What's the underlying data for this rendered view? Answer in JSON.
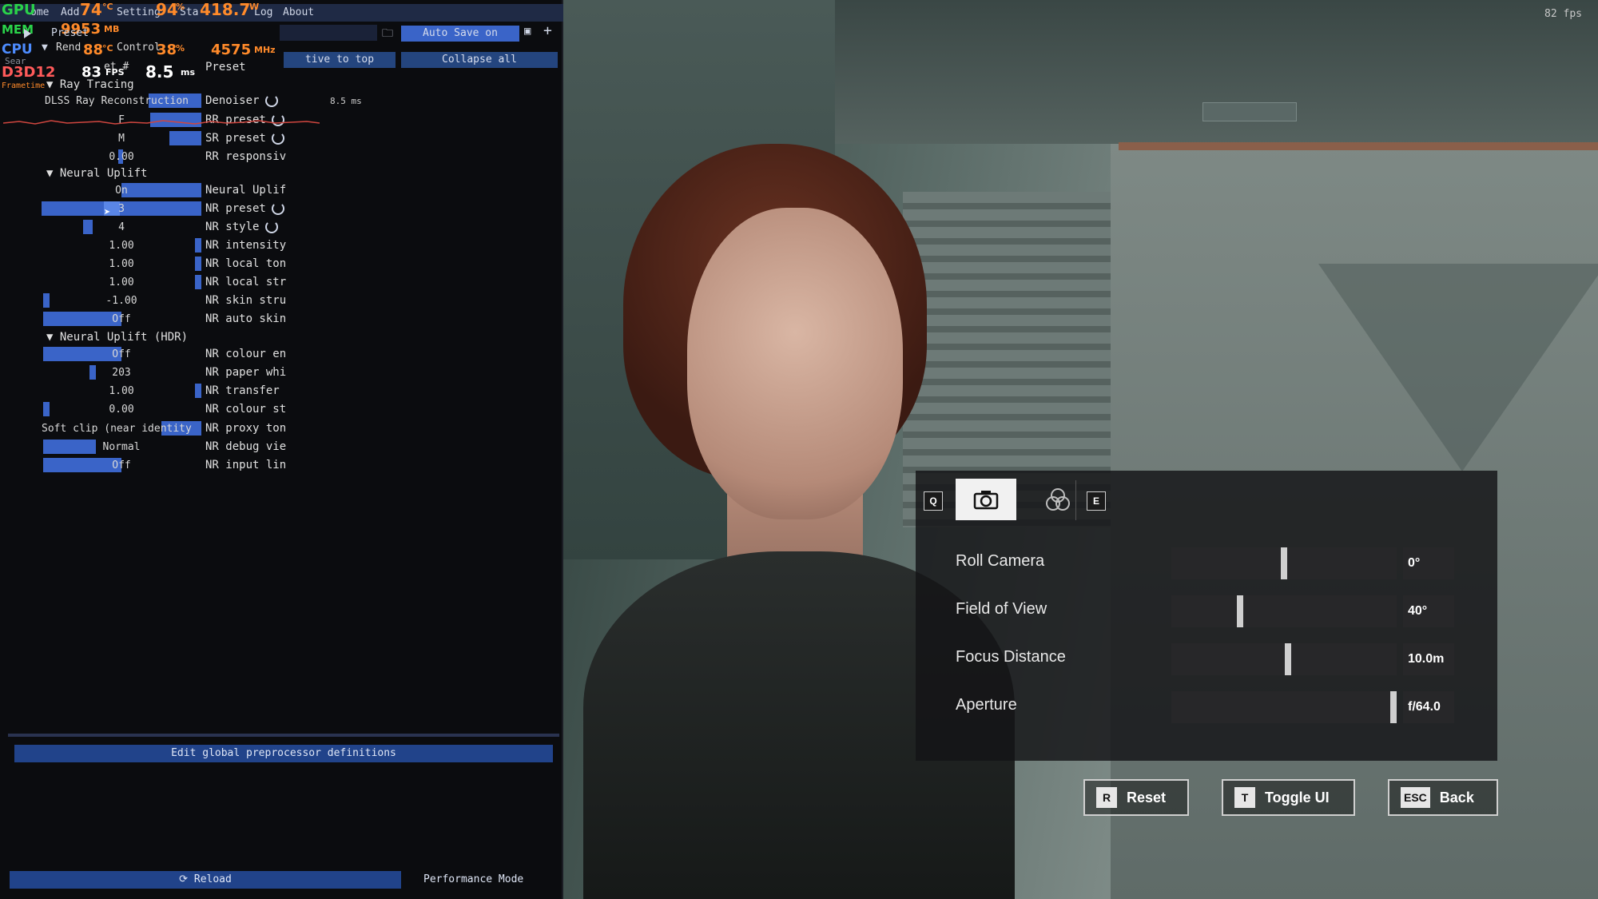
{
  "scene": {
    "fps_counter": "82 fps"
  },
  "debug_panel": {
    "menu": [
      "ome",
      "Add",
      "Setting",
      "Sta",
      "Log",
      "About"
    ],
    "overlay": {
      "gpu_label": "GPU",
      "gpu_temp": "74",
      "gpu_temp_unit": "°C",
      "gpu_load": "94",
      "gpu_load_unit": "%",
      "gpu_power": "418.7",
      "gpu_power_unit": "W",
      "mem_label": "MEM",
      "mem_value": "9953",
      "mem_unit": "MB",
      "cpu_label": "CPU",
      "cpu_temp": "88",
      "cpu_temp_unit": "°C",
      "cpu_load": "38",
      "cpu_load_unit": "%",
      "cpu_clock": "4575",
      "cpu_clock_unit": "MHz",
      "api_label": "D3D12",
      "fps": "83",
      "fps_unit": "FPS",
      "frametime": "8.5",
      "frametime_unit": "ms",
      "frametime_label": "Frametime",
      "graph_ms": "8.5 ms"
    },
    "toolbar": {
      "preset_label": "Preset",
      "autosave": "Auto Save on",
      "render_label": "Rend",
      "control_label": "Control",
      "set_label": "et #",
      "search_label": "Sear",
      "preset_row": "Preset",
      "active_to_top": "tive to top",
      "collapse_all": "Collapse all"
    },
    "sections": {
      "ray_tracing": "Ray Tracing",
      "neural_uplift": "Neural Uplift",
      "neural_uplift_hdr": "Neural Uplift (HDR)"
    },
    "rows": [
      {
        "value": "DLSS Ray Reconstruction",
        "label": "Denoiser"
      },
      {
        "value": "F",
        "label": "RR preset"
      },
      {
        "value": "M",
        "label": "SR preset"
      },
      {
        "value": "0.00",
        "label": "RR responsiv"
      },
      {
        "value": "On",
        "label": "Neural Uplif"
      },
      {
        "value": "3",
        "label": "NR preset"
      },
      {
        "value": "4",
        "label": "NR style"
      },
      {
        "value": "1.00",
        "label": "NR intensity"
      },
      {
        "value": "1.00",
        "label": "NR local ton"
      },
      {
        "value": "1.00",
        "label": "NR local str"
      },
      {
        "value": "-1.00",
        "label": "NR skin stru"
      },
      {
        "value": "Off",
        "label": "NR auto skin"
      },
      {
        "value": "Off",
        "label": "NR colour en"
      },
      {
        "value": "203",
        "label": "NR paper whi"
      },
      {
        "value": "1.00",
        "label": "NR transfer"
      },
      {
        "value": "0.00",
        "label": "NR colour st"
      },
      {
        "value": "Soft clip (near identity",
        "label": "NR proxy ton"
      },
      {
        "value": "Normal",
        "label": "NR debug vie"
      },
      {
        "value": "Off",
        "label": "NR input lin"
      }
    ],
    "edit_defs": "Edit global preprocessor definitions",
    "reload": "Reload",
    "performance_mode": "Performance Mode"
  },
  "photo_mode": {
    "key_prev": "Q",
    "key_next": "E",
    "tab_camera_icon": "camera-icon",
    "tab_filter_icon": "color-filter-icon",
    "sliders": [
      {
        "label": "Roll Camera",
        "value": "0°",
        "level": 0.5
      },
      {
        "label": "Field of View",
        "value": "40°",
        "level": 0.3
      },
      {
        "label": "Focus Distance",
        "value": "10.0m",
        "level": 0.52
      },
      {
        "label": "Aperture",
        "value": "f/64.0",
        "level": 1.0
      }
    ],
    "buttons": {
      "reset_key": "R",
      "reset": "Reset",
      "toggle_key": "T",
      "toggle": "Toggle UI",
      "back_key": "ESC",
      "back": "Back"
    }
  }
}
